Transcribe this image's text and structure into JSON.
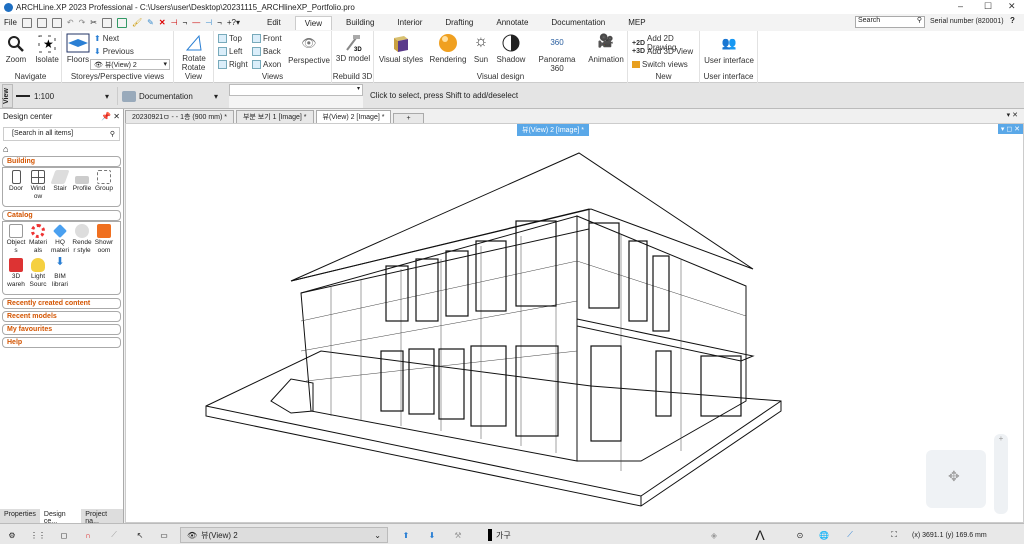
{
  "window": {
    "title": "ARCHLine.XP 2023 Professional - C:\\Users\\user\\Desktop\\20231115_ARCHlineXP_Portfolio.pro",
    "minimize": "–",
    "maximize": "☐",
    "close": "✕"
  },
  "menu": {
    "file": "File",
    "tabs": [
      "Edit",
      "View",
      "Building",
      "Interior",
      "Drafting",
      "Annotate",
      "Documentation",
      "MEP"
    ],
    "active_tab": "View",
    "search_placeholder": "Search",
    "serial": "Serial number (820001)",
    "help": "?"
  },
  "ribbon": {
    "navigate": {
      "label": "Navigate",
      "zoom": "Zoom",
      "isolate": "Isolate"
    },
    "storeys": {
      "label": "Storeys/Perspective views",
      "floors": "Floors",
      "next": "Next",
      "previous": "Previous",
      "view_select": "뷰(View) 2"
    },
    "rotate_view": {
      "label": "Rotate View",
      "rotate": "Rotate"
    },
    "views": {
      "label": "Views",
      "top": "Top",
      "left": "Left",
      "right": "Right",
      "front": "Front",
      "back": "Back",
      "axon": "Axon",
      "perspective": "Perspective"
    },
    "rebuild": {
      "label": "Rebuild 3D",
      "model": "3D model"
    },
    "visual": {
      "label": "Visual design",
      "visual_styles": "Visual styles",
      "rendering": "Rendering",
      "sun": "Sun",
      "shadow": "Shadow",
      "panorama": "Panorama 360",
      "animation": "Animation"
    },
    "new": {
      "label": "New",
      "add2d": "Add 2D Drawing",
      "add3d": "Add 3D View",
      "switch": "Switch views"
    },
    "ui": {
      "label": "User interface",
      "user_interface": "User interface"
    }
  },
  "toolbar2": {
    "side_label": "View",
    "scale": "1:100",
    "layer_set": "Documentation",
    "input_value": "",
    "hint": "Click to select, press Shift to add/deselect"
  },
  "design_center": {
    "title": "Design center",
    "search_placeholder": "[Search in all items]",
    "building": {
      "title": "Building",
      "items": [
        "Door",
        "Wind ow",
        "Stair",
        "Profile",
        "Group"
      ]
    },
    "catalog": {
      "title": "Catalog",
      "items": [
        "Object s",
        "Materi als",
        "HQ materi",
        "Rende r style",
        "Showr oom",
        "3D wareh",
        "Light Sourc",
        "BIM librari"
      ]
    },
    "sections": [
      "Recently created content",
      "Recent models",
      "My favourites",
      "Help"
    ],
    "bottom_tabs": [
      "Properties",
      "Design ce...",
      "Project na..."
    ]
  },
  "doc_tabs": [
    "20230921ㅁ - - 1층 (900 mm) *",
    "부분 보기 1 [Image] *",
    "뷰(View) 2 [Image] *",
    "+"
  ],
  "viewport": {
    "title": "뷰(View) 2 [Image] *"
  },
  "status": {
    "view": "뷰(View) 2",
    "layer": "가구",
    "coords": "(x) 3691.1   (y) 169.6 mm"
  }
}
